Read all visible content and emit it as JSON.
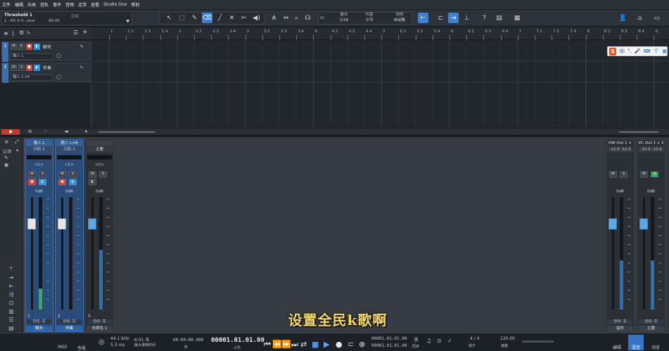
{
  "menu": [
    "文件",
    "编辑",
    "乐曲",
    "音轨",
    "事件",
    "音频",
    "走带",
    "查看",
    "Studio One",
    "帮助"
  ],
  "song": {
    "title": "Threshold 1",
    "device": "1 - RX 9 V...oice",
    "level": "-96.00",
    "sub": "控制"
  },
  "toolbar": {
    "quantize_label": "量化",
    "quantize_value": "1/16",
    "timebase_label": "时基",
    "timebase_value": "小节",
    "snap_label": "吸附",
    "snap_value": "自动吸",
    "iq": "IQ"
  },
  "ruler": [
    "1",
    "1.2",
    "1.3",
    "1.4",
    "2",
    "2.2",
    "2.3",
    "2.4",
    "3",
    "3.2",
    "3.3",
    "3.4",
    "4",
    "4.2",
    "4.3",
    "4.4",
    "5",
    "5.2",
    "5.3",
    "5.4",
    "6",
    "6.2",
    "6.3",
    "6.4",
    "7",
    "7.2",
    "7.3",
    "7.4",
    "8",
    "8.2",
    "8.3",
    "8.4",
    "9"
  ],
  "tracks": [
    {
      "num": "1",
      "name": "聊天",
      "input": "输入 L",
      "m": "M",
      "s": "S"
    },
    {
      "num": "2",
      "name": "伴奏",
      "input": "输入 L+R",
      "m": "M",
      "s": "S"
    }
  ],
  "ime": {
    "logo": "S",
    "lang": "中"
  },
  "strips": [
    {
      "header": "输入 L",
      "insert": "凸轨 1",
      "pan": "<C>",
      "vol": "0dB",
      "num": "1",
      "footer": "自动: 关",
      "name": "聊天"
    },
    {
      "header": "输入 L+R",
      "insert": "凸轨 1",
      "pan": "<C>",
      "vol": "0dB",
      "num": "2",
      "footer": "自动: 关",
      "name": "伴奏"
    },
    {
      "header": "",
      "insert": "主要",
      "pan": "<C>",
      "vol": "0dB",
      "num": "5",
      "footer": "自动: 关",
      "name": "效果轨 1"
    }
  ],
  "outputs": [
    {
      "header": "HW Out 1 + 2",
      "insert": "-12.0  -12.0",
      "vol": "0dB",
      "footer": "自动: 关",
      "name": "监听"
    },
    {
      "header": "VC Out 1 + 2",
      "insert": "-12.0  -12.0",
      "vol": "0dB",
      "footer": "自动: 关",
      "name": "主要"
    }
  ],
  "console_left": {
    "label": "认领"
  },
  "subtitle": "设置全民k歌啊",
  "transport": {
    "midi": "MIDI",
    "perf": "性能",
    "rate": "44.1 kHz",
    "latency": "5.3 ms",
    "record_time": "6:01 天",
    "record_sub": "最大录制时间",
    "time": "00:00:00.000",
    "time_label": "秒",
    "bars": "00001.01.01.00",
    "bars_label": "小节",
    "loop_start": "00001.01.01.00",
    "loop_end": "00001.01.01.00",
    "off": "关",
    "sync": "同步",
    "signature": "4 / 4",
    "sig_label": "拍子",
    "tempo": "120.00",
    "tempo_label": "速度",
    "edit": "编辑",
    "mix": "混音",
    "browse": "浏览"
  }
}
